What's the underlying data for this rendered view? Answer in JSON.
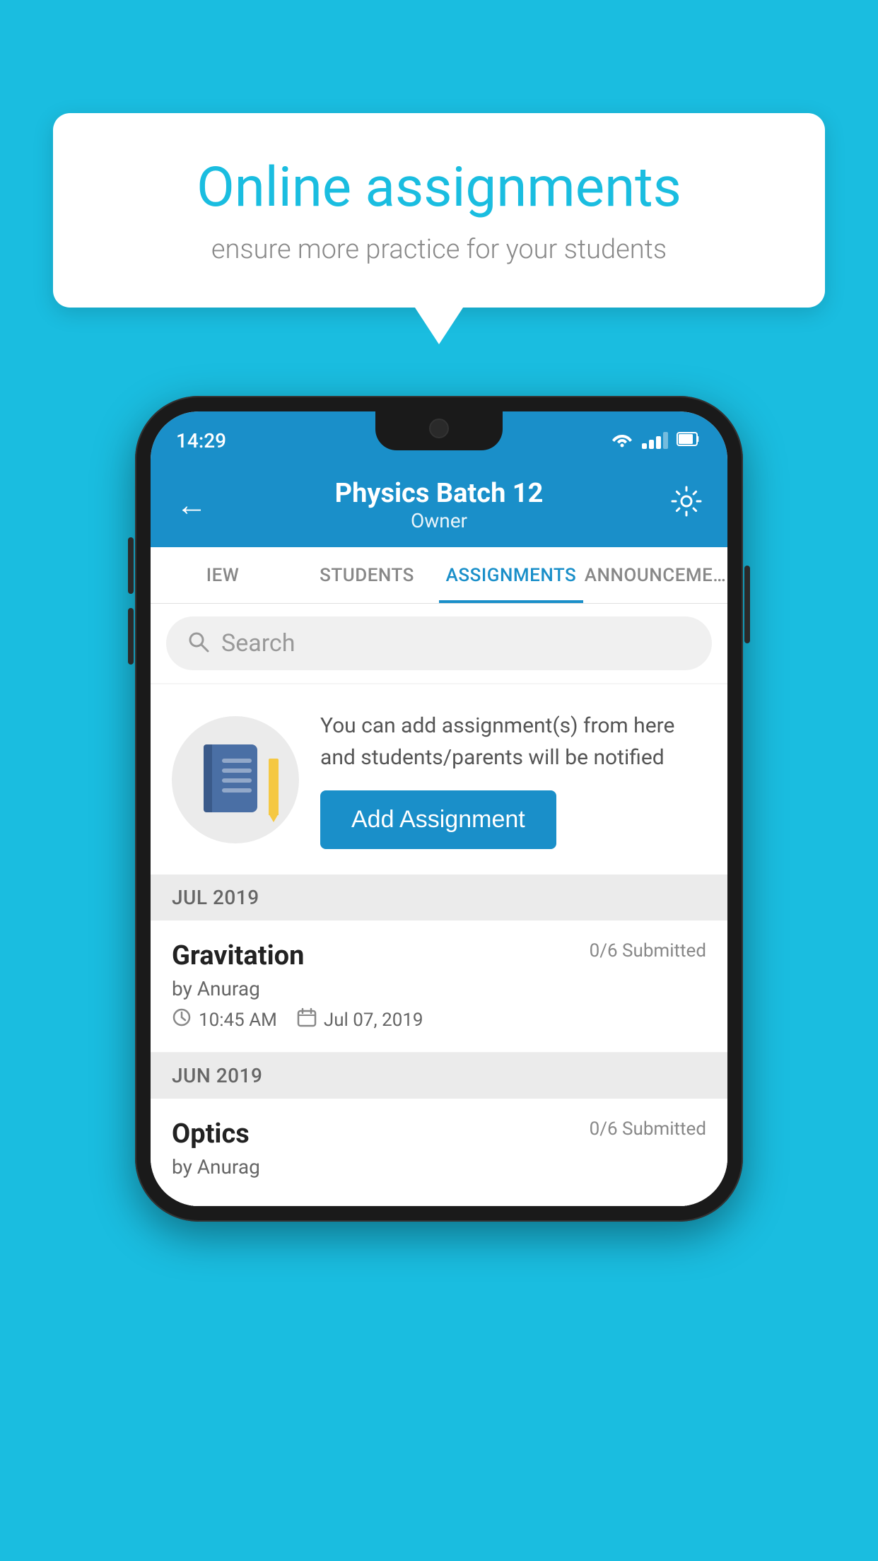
{
  "background": {
    "color": "#1ABDE0"
  },
  "speech_bubble": {
    "title": "Online assignments",
    "subtitle": "ensure more practice for your students"
  },
  "phone": {
    "status_bar": {
      "time": "14:29"
    },
    "header": {
      "title": "Physics Batch 12",
      "subtitle": "Owner",
      "back_label": "←",
      "settings_label": "⚙"
    },
    "tabs": [
      {
        "label": "IEW",
        "active": false
      },
      {
        "label": "STUDENTS",
        "active": false
      },
      {
        "label": "ASSIGNMENTS",
        "active": true
      },
      {
        "label": "ANNOUNCEME…",
        "active": false
      }
    ],
    "search": {
      "placeholder": "Search"
    },
    "cta": {
      "description": "You can add assignment(s) from here and students/parents will be notified",
      "button_label": "Add Assignment"
    },
    "sections": [
      {
        "header": "JUL 2019",
        "assignments": [
          {
            "title": "Gravitation",
            "submitted": "0/6 Submitted",
            "author": "by Anurag",
            "time": "10:45 AM",
            "date": "Jul 07, 2019"
          }
        ]
      },
      {
        "header": "JUN 2019",
        "assignments": [
          {
            "title": "Optics",
            "submitted": "0/6 Submitted",
            "author": "by Anurag",
            "time": "",
            "date": ""
          }
        ]
      }
    ]
  }
}
